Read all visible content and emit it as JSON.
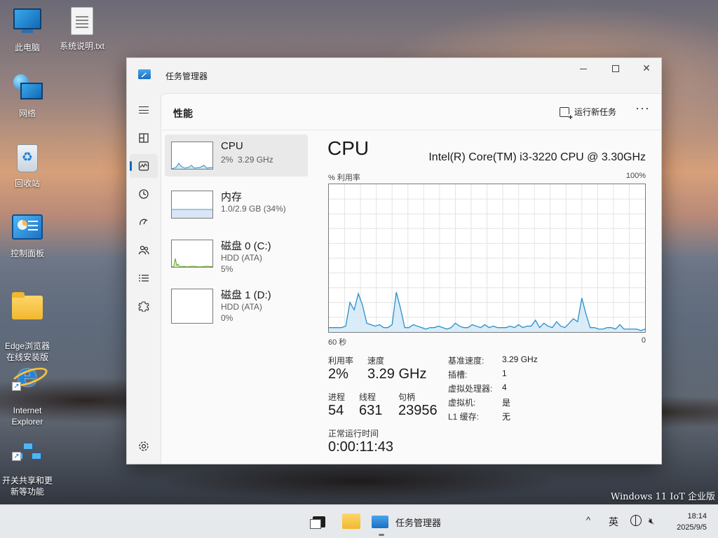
{
  "desktop": {
    "icons": [
      {
        "label": "此电脑"
      },
      {
        "label": "系统说明.txt"
      },
      {
        "label": "网络"
      },
      {
        "label": "回收站"
      },
      {
        "label": "控制面板"
      },
      {
        "label": "Edge浏览器\n在线安装版"
      },
      {
        "label": "Internet\nExplorer"
      },
      {
        "label": "开关共享和更\n新等功能"
      }
    ],
    "watermark": "Windows 11 IoT 企业版"
  },
  "window": {
    "title": "任务管理器",
    "page_title": "性能",
    "run_new_task": "运行新任务",
    "more": "···",
    "nav_icons": [
      "hamburger-icon",
      "processes-icon",
      "performance-icon",
      "app-history-icon",
      "startup-icon",
      "users-icon",
      "details-icon",
      "services-icon",
      "settings-icon"
    ],
    "list": [
      {
        "name": "CPU",
        "sub": "2%  3.29 GHz",
        "sub2": ""
      },
      {
        "name": "内存",
        "sub": "1.0/2.9 GB (34%)",
        "sub2": ""
      },
      {
        "name": "磁盘 0 (C:)",
        "sub": "HDD (ATA)",
        "sub2": "5%"
      },
      {
        "name": "磁盘 1 (D:)",
        "sub": "HDD (ATA)",
        "sub2": "0%"
      }
    ],
    "detail": {
      "title": "CPU",
      "model": "Intel(R) Core(TM) i3-3220 CPU @ 3.30GHz",
      "util_label": "% 利用率",
      "max_label": "100%",
      "seconds_label": "60 秒",
      "zero_label": "0",
      "stats": {
        "util_label": "利用率",
        "util_value": "2%",
        "speed_label": "速度",
        "speed_value": "3.29 GHz",
        "proc_label": "进程",
        "proc_value": "54",
        "threads_label": "线程",
        "threads_value": "631",
        "handles_label": "句柄",
        "handles_value": "23956",
        "uptime_label": "正常运行时间",
        "uptime_value": "0:00:11:43"
      },
      "info": [
        {
          "key": "基准速度:",
          "value": "3.29 GHz"
        },
        {
          "key": "插槽:",
          "value": "1"
        },
        {
          "key": "虚拟处理器:",
          "value": "4"
        },
        {
          "key": "虚拟机:",
          "value": "是"
        },
        {
          "key": "L1 缓存:",
          "value": "无"
        }
      ]
    }
  },
  "chart_data": {
    "type": "area",
    "ylim": [
      0,
      100
    ],
    "xlabel": "60 秒",
    "ylabel": "% 利用率",
    "series": [
      {
        "values": [
          3,
          3,
          3,
          3,
          4,
          20,
          15,
          26,
          18,
          6,
          5,
          4,
          5,
          3,
          3,
          5,
          27,
          16,
          3,
          3,
          5,
          4,
          3,
          2,
          3,
          3,
          4,
          3,
          2,
          3,
          6,
          4,
          3,
          3,
          5,
          4,
          3,
          5,
          3,
          4,
          3,
          3,
          3,
          4,
          3,
          5,
          3,
          4,
          4,
          8,
          3,
          6,
          4,
          3,
          7,
          4,
          3,
          6,
          9,
          7,
          23,
          12,
          3,
          3,
          2,
          2,
          3,
          3,
          2,
          5,
          2,
          2,
          2,
          2,
          1,
          2
        ]
      }
    ],
    "color_line": "#2b8fc9",
    "color_fill": "#cfe7f6"
  },
  "taskbar": {
    "app_label": "任务管理器",
    "tray_chevron": "^",
    "ime": "英",
    "time": "18:14",
    "date": "2025/9/5"
  }
}
